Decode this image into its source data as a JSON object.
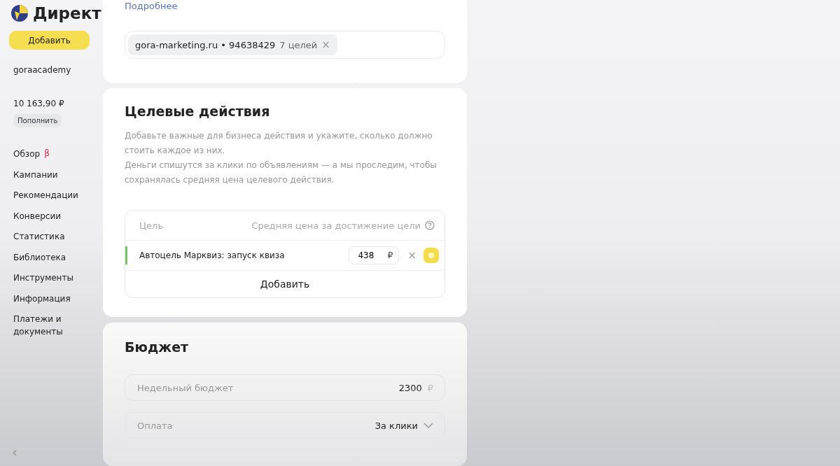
{
  "sidebar": {
    "logo": "Директ",
    "add_button": "Добавить",
    "account": "goraacademy",
    "balance": "10 163,90 ₽",
    "topup_button": "Пополнить",
    "items": [
      {
        "label": "Обзор",
        "badge": "β"
      },
      {
        "label": "Кампании"
      },
      {
        "label": "Рекомендации"
      },
      {
        "label": "Конверсии"
      },
      {
        "label": "Статистика"
      },
      {
        "label": "Библиотека"
      },
      {
        "label": "Инструменты"
      },
      {
        "label": "Информация"
      },
      {
        "label": "Платежи и документы"
      }
    ],
    "collapse": "‹"
  },
  "counter_card": {
    "link": "Подробнее",
    "chip": {
      "name": "gora-marketing.ru • 94638429",
      "count": "7 целей",
      "remove": "×"
    }
  },
  "goals_card": {
    "title": "Целевые действия",
    "description": "Добавьте важные для бизнеса действия и укажите, сколько должно стоить каждое из них.\nДеньги спишутся за клики по объявлениям — а мы проследим, чтобы сохранялась средняя цена целевого действия.",
    "table": {
      "columns": [
        "Цель",
        "Средняя цена за достижение цели"
      ],
      "rows": [
        {
          "goal": "Автоцель Марквиз: запуск квиза",
          "price": "438",
          "currency": "₽",
          "remove": "×"
        }
      ],
      "add_button": "Добавить"
    }
  },
  "budget_card": {
    "title": "Бюджет",
    "fields": [
      {
        "kind": "input",
        "label": "Недельный бюджет",
        "value": "2300",
        "suffix": "₽"
      },
      {
        "kind": "select",
        "label": "Оплата",
        "value": "За клики"
      }
    ]
  }
}
